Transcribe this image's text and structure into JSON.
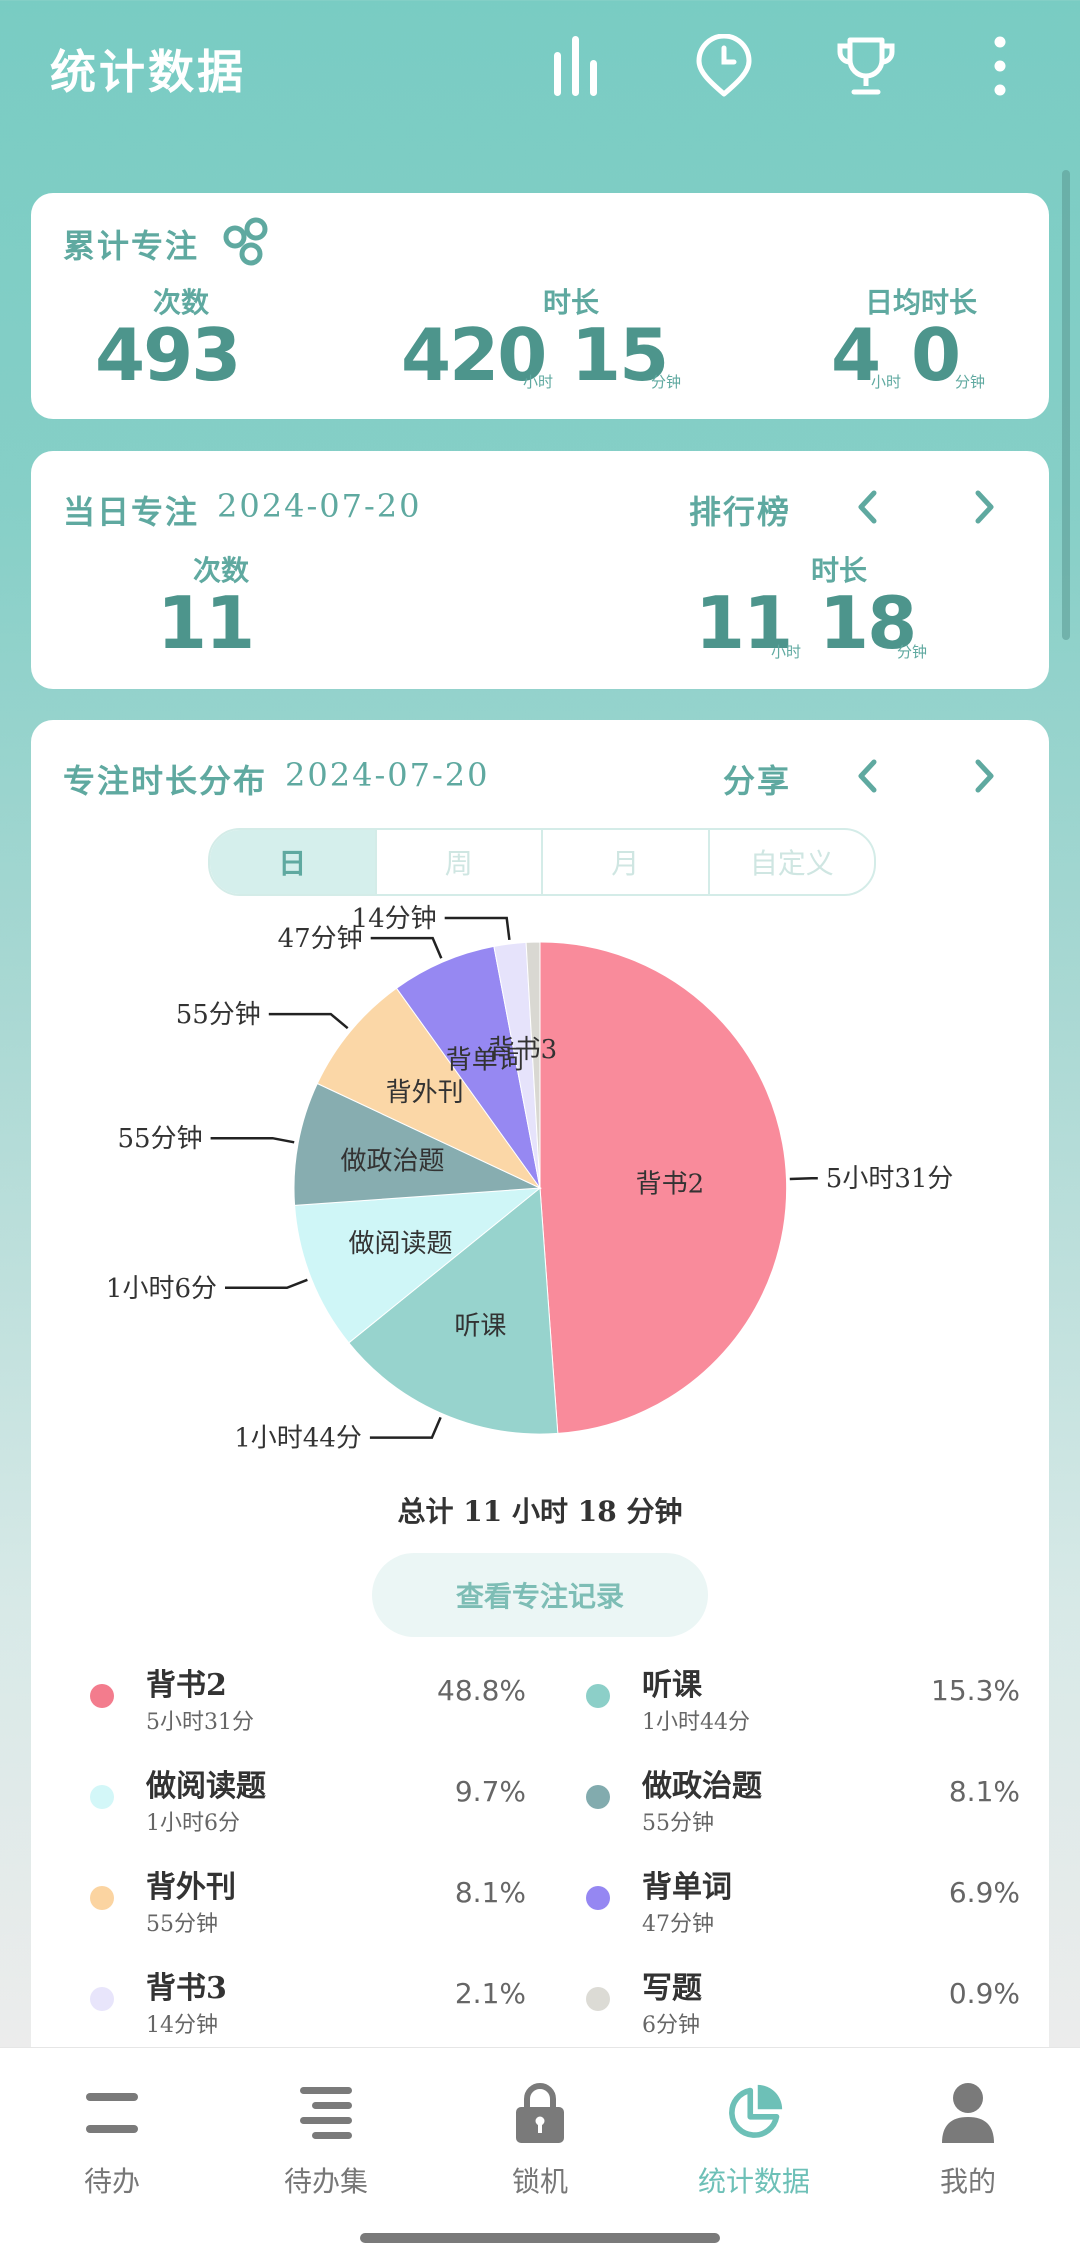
{
  "header": {
    "title": "统计数据",
    "icons": [
      "bar-chart-icon",
      "clock-pin-icon",
      "trophy-icon",
      "more-vertical-icon"
    ]
  },
  "cumulative": {
    "title": "累计专注",
    "count_label": "次数",
    "count": "493",
    "duration_label": "时长",
    "duration_hours": "420",
    "duration_minutes": "15",
    "daily_avg_label": "日均时长",
    "avg_hours": "4",
    "avg_minutes": "0",
    "unit_hour": "小时",
    "unit_minute": "分钟"
  },
  "daily": {
    "title": "当日专注",
    "date": "2024-07-20",
    "leaderboard_label": "排行榜",
    "count_label": "次数",
    "count": "11",
    "duration_label": "时长",
    "hours": "11",
    "minutes": "18",
    "unit_hour": "小时",
    "unit_minute": "分钟"
  },
  "distribution": {
    "title": "专注时长分布",
    "date": "2024-07-20",
    "share_label": "分享",
    "tabs": [
      "日",
      "周",
      "月",
      "自定义"
    ],
    "active_tab": "日",
    "total_text": "总计 11 小时 18 分钟",
    "record_button": "查看专注记录"
  },
  "chart_data": {
    "type": "pie",
    "title": "",
    "slices": [
      {
        "label": "背书2",
        "duration": "5小时31分",
        "value": 48.8,
        "color": "#f98b9b"
      },
      {
        "label": "听课",
        "duration": "1小时44分",
        "value": 15.3,
        "color": "#97d3cd"
      },
      {
        "label": "做阅读题",
        "duration": "1小时6分",
        "value": 9.7,
        "color": "#cff6f7"
      },
      {
        "label": "做政治题",
        "duration": "55分钟",
        "value": 8.1,
        "color": "#87adb0"
      },
      {
        "label": "背外刊",
        "duration": "55分钟",
        "value": 8.1,
        "color": "#fbd7a7"
      },
      {
        "label": "背单词",
        "duration": "47分钟",
        "value": 6.9,
        "color": "#9688f2"
      },
      {
        "label": "背书3",
        "duration": "14分钟",
        "value": 2.1,
        "color": "#e6e3fb"
      },
      {
        "label": "写题",
        "duration": "6分钟",
        "value": 0.9,
        "color": "#d9d8d2"
      }
    ],
    "outer_labels": [
      "5小时31分",
      "1小时44分",
      "1小时6分",
      "55分钟",
      "55分钟",
      "47分钟",
      "14分钟"
    ]
  },
  "legend": [
    {
      "name": "背书2",
      "duration": "5小时31分",
      "percent": "48.8%",
      "color": "#f37c8d"
    },
    {
      "name": "听课",
      "duration": "1小时44分",
      "percent": "15.3%",
      "color": "#8ccfc8"
    },
    {
      "name": "做阅读题",
      "duration": "1小时6分",
      "percent": "9.7%",
      "color": "#d3f7f8"
    },
    {
      "name": "做政治题",
      "duration": "55分钟",
      "percent": "8.1%",
      "color": "#82abae"
    },
    {
      "name": "背外刊",
      "duration": "55分钟",
      "percent": "8.1%",
      "color": "#fbd4a1"
    },
    {
      "name": "背单词",
      "duration": "47分钟",
      "percent": "6.9%",
      "color": "#9587f2"
    },
    {
      "name": "背书3",
      "duration": "14分钟",
      "percent": "2.1%",
      "color": "#e8e5fb"
    },
    {
      "name": "写题",
      "duration": "6分钟",
      "percent": "0.9%",
      "color": "#dcdbd5"
    }
  ],
  "bottom_nav": [
    {
      "label": "待办",
      "icon": "todo-list-icon",
      "active": false
    },
    {
      "label": "待办集",
      "icon": "todo-set-icon",
      "active": false
    },
    {
      "label": "锁机",
      "icon": "lock-icon",
      "active": false
    },
    {
      "label": "统计数据",
      "icon": "pie-chart-icon",
      "active": true
    },
    {
      "label": "我的",
      "icon": "profile-icon",
      "active": false
    }
  ]
}
